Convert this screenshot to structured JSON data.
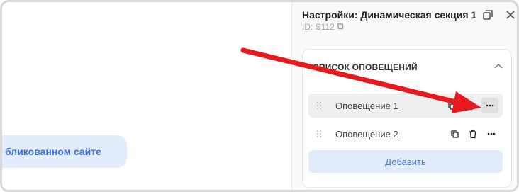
{
  "canvas": {
    "button_label": "бликованном сайте"
  },
  "panel": {
    "title": "Настройки: Динамическая секция 1",
    "id_label": "ID: S112",
    "section_title": "СПИСОК ОПОВЕЩЕНИЙ",
    "items": [
      {
        "label": "Оповещение 1"
      },
      {
        "label": "Оповещение 2"
      }
    ],
    "add_label": "Добавить"
  },
  "colors": {
    "accent": "#3f6fd8",
    "accent_bg": "#e3ecfb",
    "annotation_arrow": "#e8191c"
  }
}
